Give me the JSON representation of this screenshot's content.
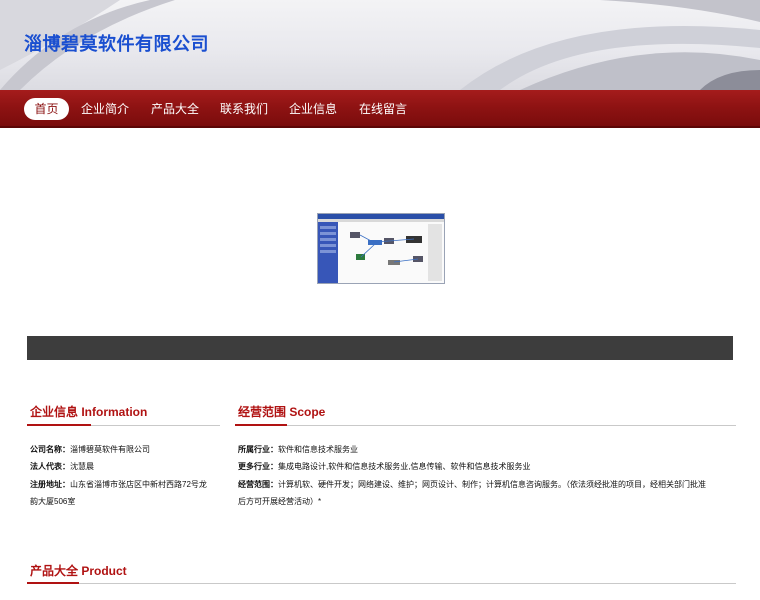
{
  "site": {
    "title": "淄博碧莫软件有限公司"
  },
  "nav": {
    "items": [
      "首页",
      "企业简介",
      "产品大全",
      "联系我们",
      "企业信息",
      "在线留言"
    ],
    "active_index": 0
  },
  "sections": {
    "company_info": {
      "title": "企业信息 Information",
      "rows": [
        {
          "label": "公司名称：",
          "value": "淄博碧莫软件有限公司"
        },
        {
          "label": "法人代表：",
          "value": "沈慧晨"
        },
        {
          "label": "注册地址：",
          "value": "山东省淄博市张店区中新村西路72号龙",
          "value2": "韵大厦506室"
        }
      ]
    },
    "scope": {
      "title": "经营范围 Scope",
      "rows": [
        {
          "label": "所属行业：",
          "value": "软件和信息技术服务业"
        },
        {
          "label": "更多行业：",
          "value": "集成电路设计,软件和信息技术服务业,信息传输、软件和信息技术服务业"
        },
        {
          "label": "经营范围：",
          "value": "计算机软、硬件开发；网络建设、维护；网页设计、制作；计算机信息咨询服务。（依法须经批准的项目，经相关部门批准",
          "value2": "后方可开展经营活动）*"
        }
      ]
    },
    "products": {
      "title": "产品大全 Product"
    }
  },
  "colors": {
    "nav_red": "#8f1313",
    "accent_red": "#b01212",
    "title_blue": "#1a4fd0",
    "dark_bar": "#3d3d3d"
  }
}
